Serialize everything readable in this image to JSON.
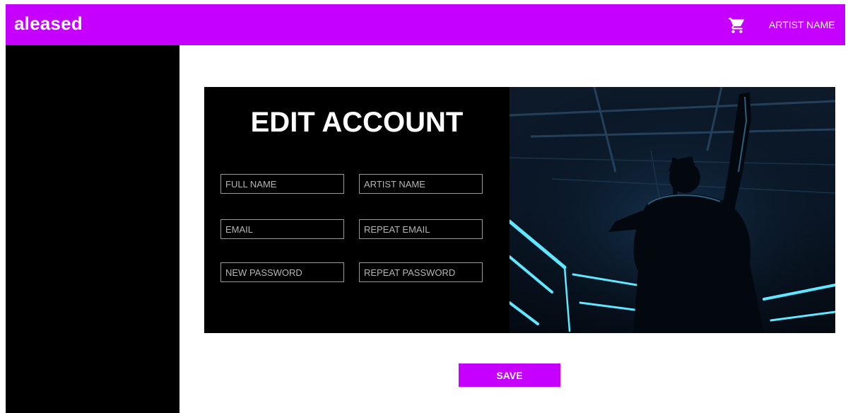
{
  "header": {
    "brand": "aleased",
    "cart_icon": "shopping-cart-icon",
    "user_label": "ARTIST NAME"
  },
  "form": {
    "title": "EDIT ACCOUNT",
    "fields": {
      "full_name": "FULL NAME",
      "artist_name": "ARTIST NAME",
      "email": "EMAIL",
      "repeat_email": "REPEAT EMAIL",
      "new_password": "NEW PASSWORD",
      "repeat_password": "REPEAT PASSWORD"
    },
    "save_label": "SAVE"
  },
  "colors": {
    "accent": "#c600ff",
    "panel": "#000000",
    "field_border": "#9a9a9a"
  }
}
